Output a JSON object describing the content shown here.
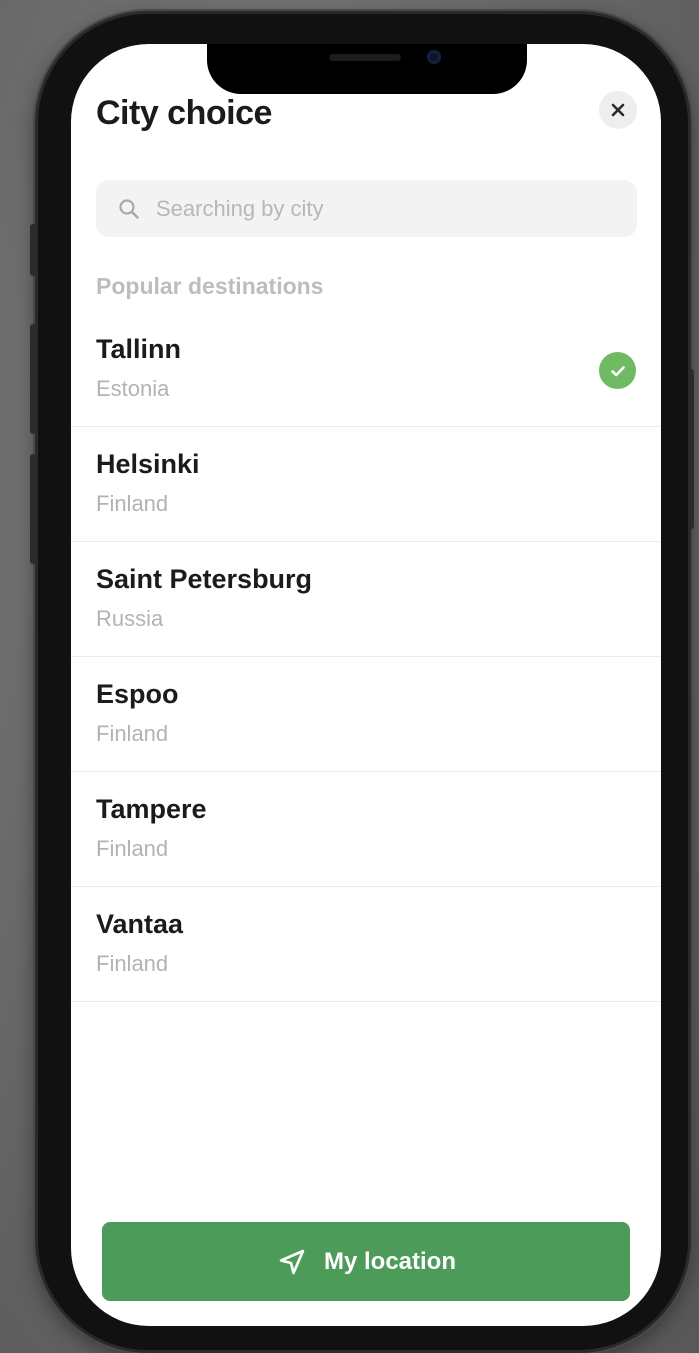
{
  "header": {
    "title": "City choice",
    "close_icon": "close-icon"
  },
  "search": {
    "placeholder": "Searching by city",
    "value": "",
    "icon": "search-icon"
  },
  "section": {
    "label": "Popular destinations"
  },
  "cities": [
    {
      "name": "Tallinn",
      "country": "Estonia",
      "selected": true
    },
    {
      "name": "Helsinki",
      "country": "Finland",
      "selected": false
    },
    {
      "name": "Saint Petersburg",
      "country": "Russia",
      "selected": false
    },
    {
      "name": "Espoo",
      "country": "Finland",
      "selected": false
    },
    {
      "name": "Tampere",
      "country": "Finland",
      "selected": false
    },
    {
      "name": "Vantaa",
      "country": "Finland",
      "selected": false
    }
  ],
  "footer": {
    "location_label": "My location",
    "location_icon": "navigation-arrow-icon"
  },
  "colors": {
    "accent": "#4c9b58",
    "check": "#6fba63",
    "secondary_text": "#b3b3b3"
  }
}
